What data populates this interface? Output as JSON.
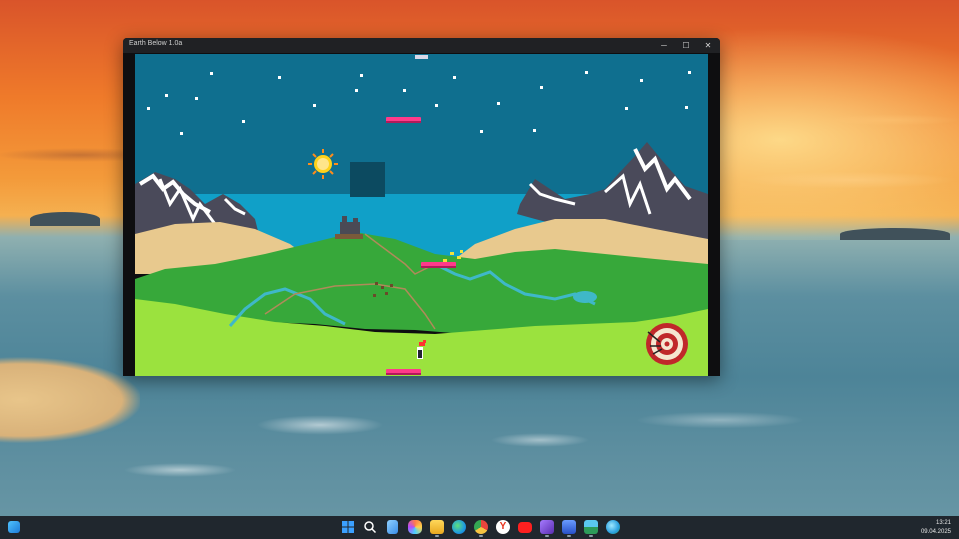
{
  "window": {
    "title": "Earth Below 1.0a",
    "controls": {
      "minimize": "─",
      "maximize": "☐",
      "close": "✕"
    }
  },
  "game": {
    "score_indicator": "",
    "icons": [
      "sun-icon",
      "castle-icon",
      "target-icon",
      "player-icon",
      "paddle-icon"
    ]
  },
  "taskbar": {
    "apps": [
      {
        "name": "start-button",
        "color": "#3ba0ff"
      },
      {
        "name": "search-button",
        "color": "#ffffff"
      },
      {
        "name": "task-view-button",
        "color": "#6ab0ff"
      },
      {
        "name": "copilot-app",
        "color": "#ff8a4a"
      },
      {
        "name": "file-explorer-app",
        "color": "#f5c542"
      },
      {
        "name": "edge-browser-app",
        "color": "#2fb3e8"
      },
      {
        "name": "chrome-browser-app",
        "color": "#e8453c"
      },
      {
        "name": "yandex-browser-app",
        "color": "#ffffff"
      },
      {
        "name": "youtube-app",
        "color": "#ff2a2a"
      },
      {
        "name": "visual-studio-app",
        "color": "#8a5bd6"
      },
      {
        "name": "save-app",
        "color": "#3d7cff"
      },
      {
        "name": "image-viewer-app",
        "color": "#2d9c5a"
      },
      {
        "name": "globe-app",
        "color": "#42c2ff"
      }
    ],
    "time": "13:21",
    "date": "09.04.2025"
  }
}
